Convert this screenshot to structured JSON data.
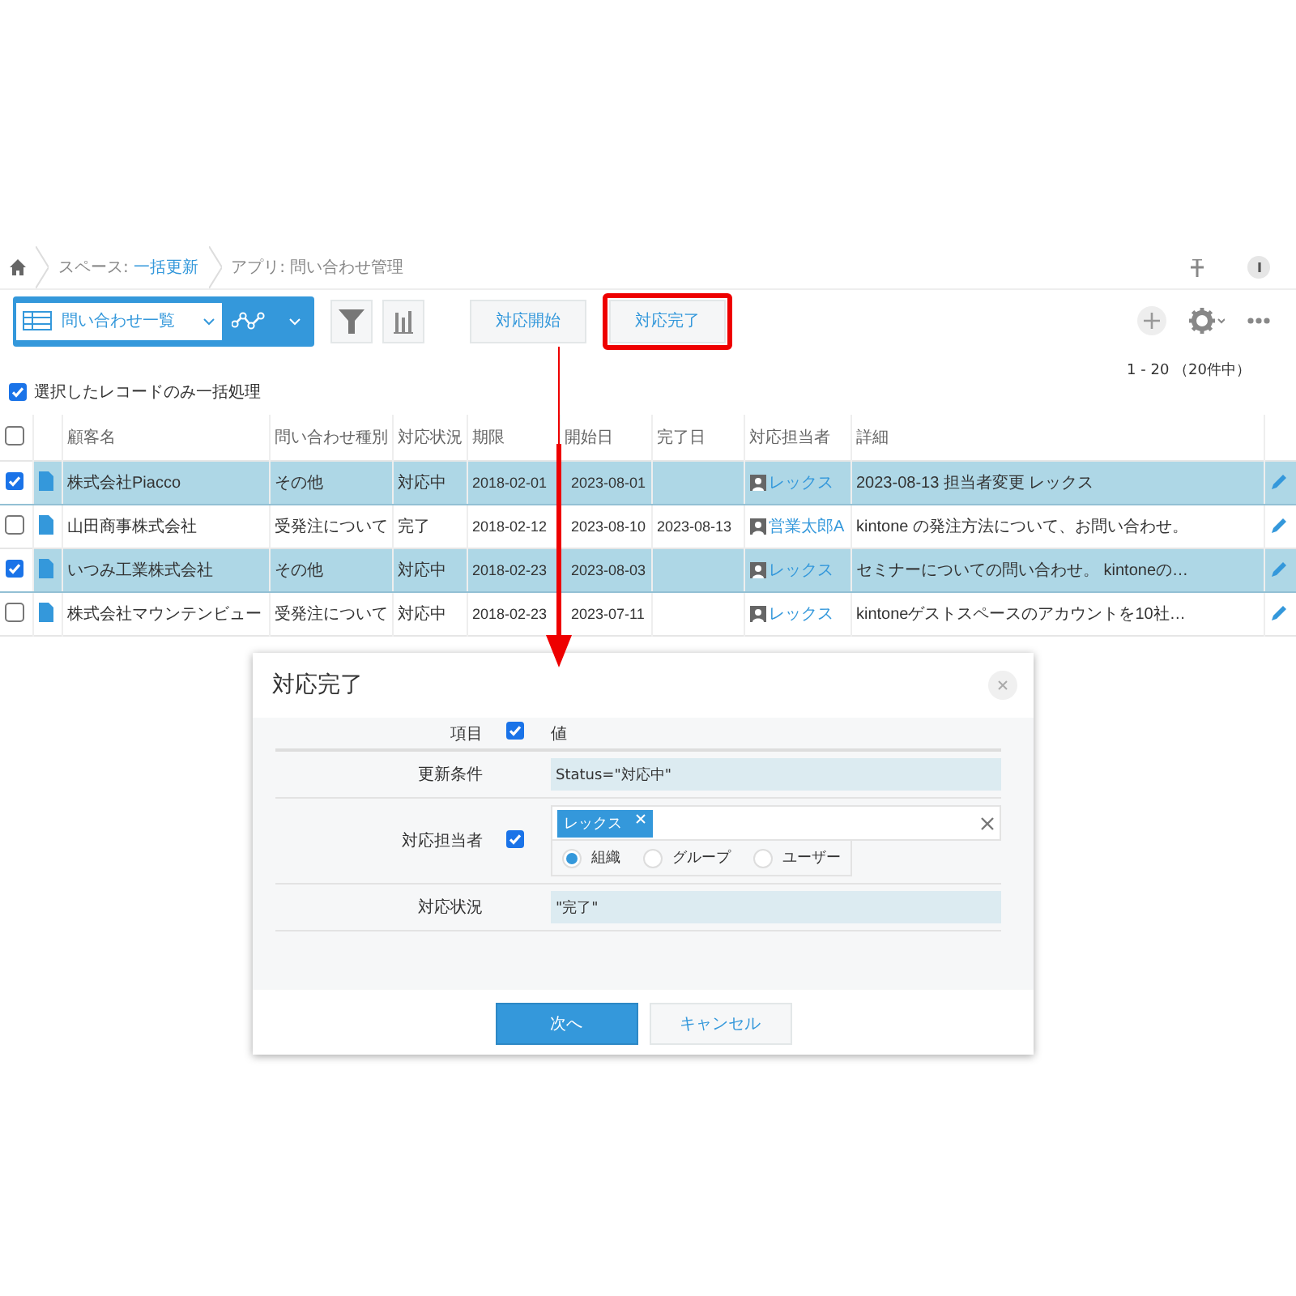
{
  "breadcrumb": {
    "space_label": "スペース:",
    "space_name": "一括更新",
    "app": "アプリ: 問い合わせ管理"
  },
  "toolbar": {
    "view": "問い合わせ一覧",
    "buttons": [
      {
        "label": "対応開始",
        "highlighted": false
      },
      {
        "label": "対応完了",
        "highlighted": true
      }
    ]
  },
  "count": "1 - 20 （20件中）",
  "bulk_option": {
    "label": "選択したレコードのみ一括処理",
    "checked": true
  },
  "table": {
    "select_all_checked": false,
    "columns": [
      "顧客名",
      "問い合わせ種別",
      "対応状況",
      "期限",
      "開始日",
      "完了日",
      "対応担当者",
      "詳細"
    ],
    "rows": [
      {
        "selected": true,
        "cells": [
          "株式会社Piacco",
          "その他",
          "対応中",
          "2018-02-01",
          "2023-08-01",
          ""
        ],
        "assignee": "レックス",
        "detail": "2023-08-13 担当者変更 レックス"
      },
      {
        "selected": false,
        "cells": [
          "山田商事株式会社",
          "受発注について",
          "完了",
          "2018-02-12",
          "2023-08-10",
          "2023-08-13"
        ],
        "assignee": "営業太郎A",
        "detail": "kintone の発注方法について、お問い合わせ。"
      },
      {
        "selected": true,
        "cells": [
          "いつみ工業株式会社",
          "その他",
          "対応中",
          "2018-02-23",
          "2023-08-03",
          ""
        ],
        "assignee": "レックス",
        "detail": "セミナーについての問い合わせ。 kintoneの…"
      },
      {
        "selected": false,
        "cells": [
          "株式会社マウンテンビュー",
          "受発注について",
          "対応中",
          "2018-02-23",
          "2023-07-11",
          ""
        ],
        "assignee": "レックス",
        "detail": "kintoneゲストスペースのアカウントを10社…"
      }
    ]
  },
  "dialog": {
    "title": "対応完了",
    "header": {
      "label": "項目",
      "checked": true,
      "value_label": "値"
    },
    "fields": [
      {
        "kind": "text",
        "label": "更新条件",
        "value": "Status=\"対応中\""
      },
      {
        "kind": "user",
        "label": "対応担当者",
        "checked": true,
        "tags": [
          "レックス"
        ],
        "options": [
          {
            "label": "組織",
            "selected": true
          },
          {
            "label": "グループ",
            "selected": false
          },
          {
            "label": "ユーザー",
            "selected": false
          }
        ]
      },
      {
        "kind": "text",
        "label": "対応状況",
        "value": "\"完了\""
      }
    ],
    "primary": "次へ",
    "cancel": "キャンセル"
  }
}
